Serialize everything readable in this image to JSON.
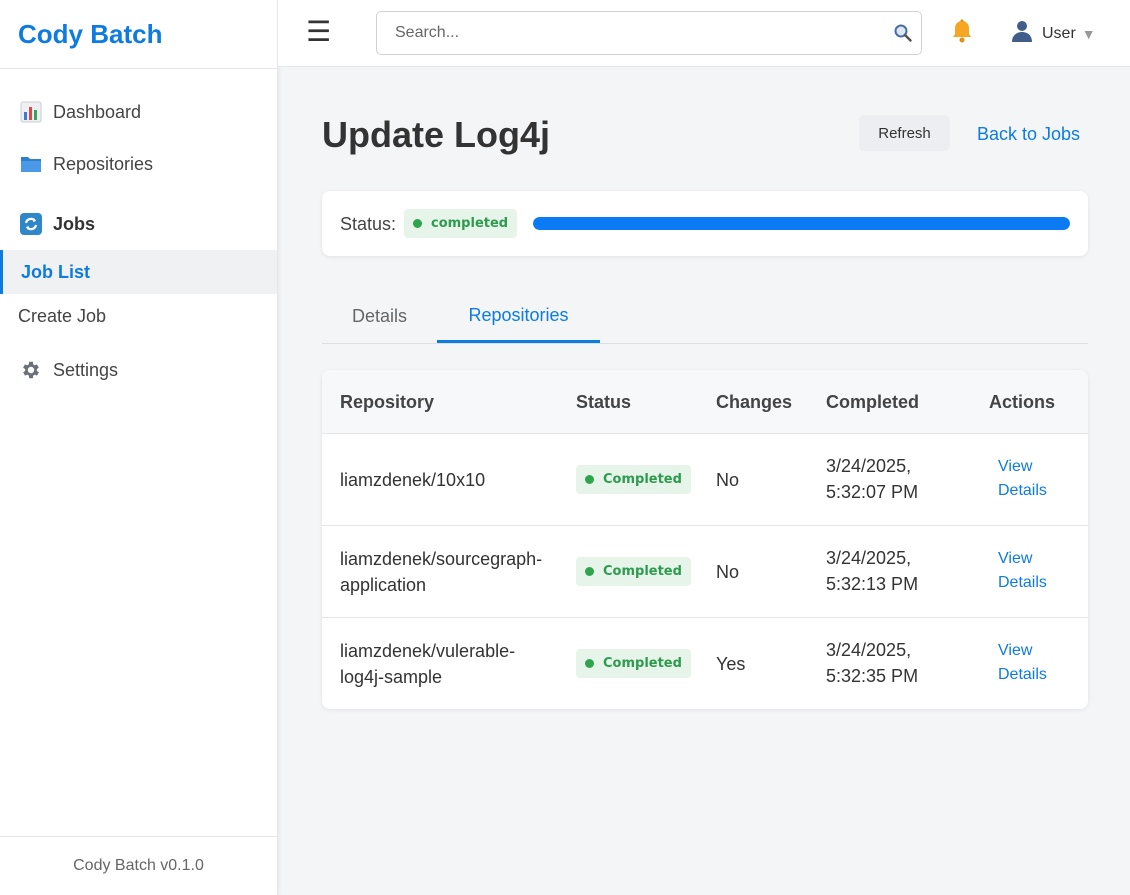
{
  "sidebar": {
    "brand": "Cody Batch",
    "items": [
      {
        "label": "Dashboard",
        "icon": "chart-icon"
      },
      {
        "label": "Repositories",
        "icon": "folder-icon"
      },
      {
        "label": "Jobs",
        "icon": "refresh-icon"
      },
      {
        "label": "Job List"
      },
      {
        "label": "Create Job"
      },
      {
        "label": "Settings",
        "icon": "gear-icon"
      }
    ],
    "footer": "Cody Batch v0.1.0"
  },
  "topbar": {
    "search_placeholder": "Search...",
    "user_label": "User",
    "caret": "▼"
  },
  "page": {
    "title": "Update Log4j",
    "refresh_label": "Refresh",
    "back_label": "Back to Jobs"
  },
  "status": {
    "label": "Status:",
    "value": "completed",
    "progress": 1.0,
    "color": "#0a7bf3"
  },
  "tabs": [
    {
      "label": "Details",
      "active": false
    },
    {
      "label": "Repositories",
      "active": true
    }
  ],
  "table": {
    "headers": [
      "Repository",
      "Status",
      "Changes",
      "Completed",
      "Actions"
    ],
    "rows": [
      {
        "repo": "liamzdenek/10x10",
        "status": "Completed",
        "changes": "No",
        "completed_date": "3/24/2025,",
        "completed_time": "5:32:07 PM",
        "action_1": "View",
        "action_2": "Details"
      },
      {
        "repo_1": "liamzdenek/sourcegraph-",
        "repo_2": "application",
        "status": "Completed",
        "changes": "No",
        "completed_date": "3/24/2025,",
        "completed_time": "5:32:13 PM",
        "action_1": "View",
        "action_2": "Details"
      },
      {
        "repo_1": "liamzdenek/vulerable-",
        "repo_2": "log4j-sample",
        "status": "Completed",
        "changes": "Yes",
        "completed_date": "3/24/2025,",
        "completed_time": "5:32:35 PM",
        "action_1": "View",
        "action_2": "Details"
      }
    ]
  },
  "colors": {
    "accent": "#0d7be0",
    "success": "#2ea44f",
    "success_bg": "#e6f4ea"
  }
}
